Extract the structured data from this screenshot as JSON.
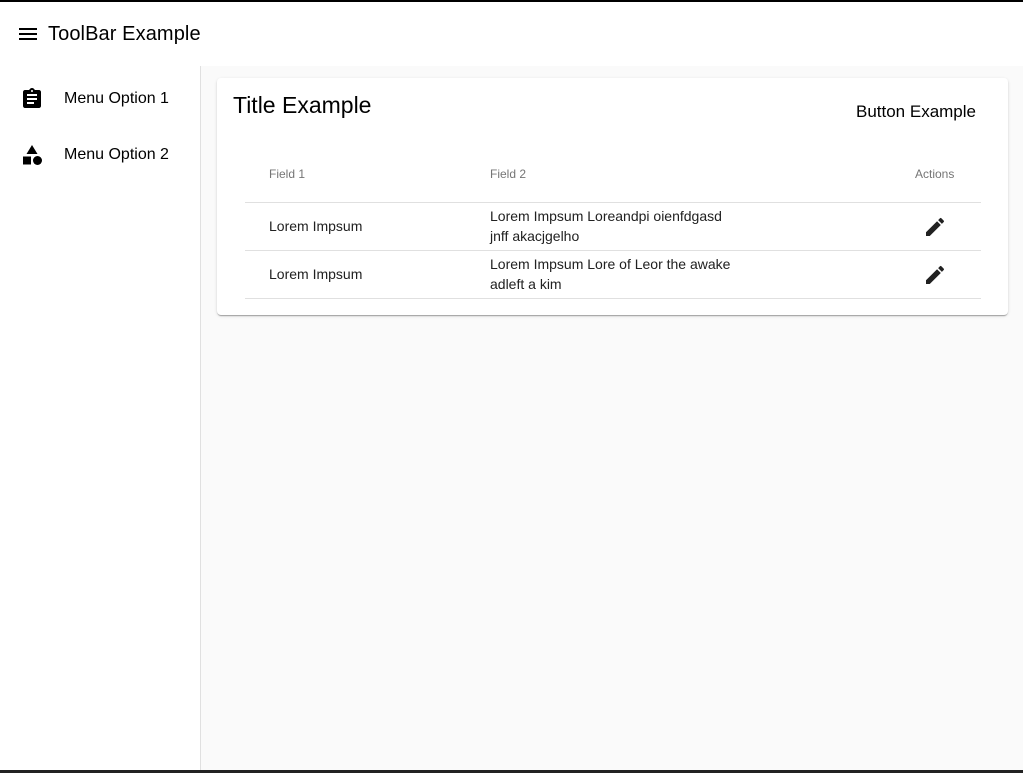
{
  "toolbar": {
    "menu_icon": "menu-icon",
    "title": "ToolBar Example"
  },
  "sidenav": {
    "items": [
      {
        "label": "Menu Option 1",
        "icon": "assignment-icon"
      },
      {
        "label": "Menu Option 2",
        "icon": "category-icon"
      }
    ]
  },
  "card": {
    "title": "Title Example",
    "button_label": "Button Example"
  },
  "table": {
    "headers": [
      "Field 1",
      "Field 2",
      "Actions"
    ],
    "rows": [
      {
        "field1": "Lorem Impsum",
        "field2": "Lorem Impsum Loreandpi oienfdgasd jnff akacjgelho",
        "action_icon": "edit-icon"
      },
      {
        "field1": "Lorem Impsum",
        "field2": "Lorem Impsum Lore of Leor the awake adleft a kim",
        "action_icon": "edit-icon"
      }
    ]
  },
  "colors": {
    "content_background": "#fafafa",
    "header_text": "#757575",
    "divider": "#e0e0e0"
  }
}
